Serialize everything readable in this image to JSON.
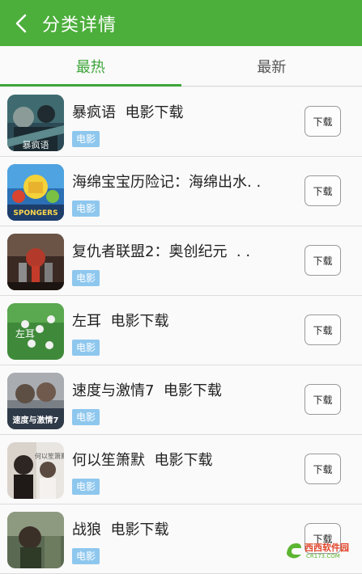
{
  "header": {
    "back_icon": "chevron-left-icon",
    "title": "分类详情"
  },
  "tabs": [
    {
      "label": "最热",
      "active": true
    },
    {
      "label": "最新",
      "active": false
    }
  ],
  "colors": {
    "brand": "#4cae3b",
    "tab_active": "#3da53a",
    "tag": "#8ec7ee"
  },
  "items": [
    {
      "title": "暴疯语  电影下载",
      "tag": "电影",
      "button": "下载",
      "poster_text": "暴疯语"
    },
    {
      "title": "海绵宝宝历险记：海绵出水. .",
      "tag": "电影",
      "button": "下载",
      "poster_text": "SPONGERS"
    },
    {
      "title": "复仇者联盟2：奥创纪元  . .",
      "tag": "电影",
      "button": "下载",
      "poster_text": ""
    },
    {
      "title": "左耳  电影下载",
      "tag": "电影",
      "button": "下载",
      "poster_text": "左耳"
    },
    {
      "title": "速度与激情7  电影下载",
      "tag": "电影",
      "button": "下载",
      "poster_text": "速度与激情7"
    },
    {
      "title": "何以笙箫默  电影下载",
      "tag": "电影",
      "button": "下载",
      "poster_text": "何以笙箫默"
    },
    {
      "title": "战狼  电影下载",
      "tag": "电影",
      "button": "下载",
      "poster_text": ""
    }
  ],
  "watermark": {
    "brand": "西西软件园",
    "domain": "CR173.COM"
  }
}
